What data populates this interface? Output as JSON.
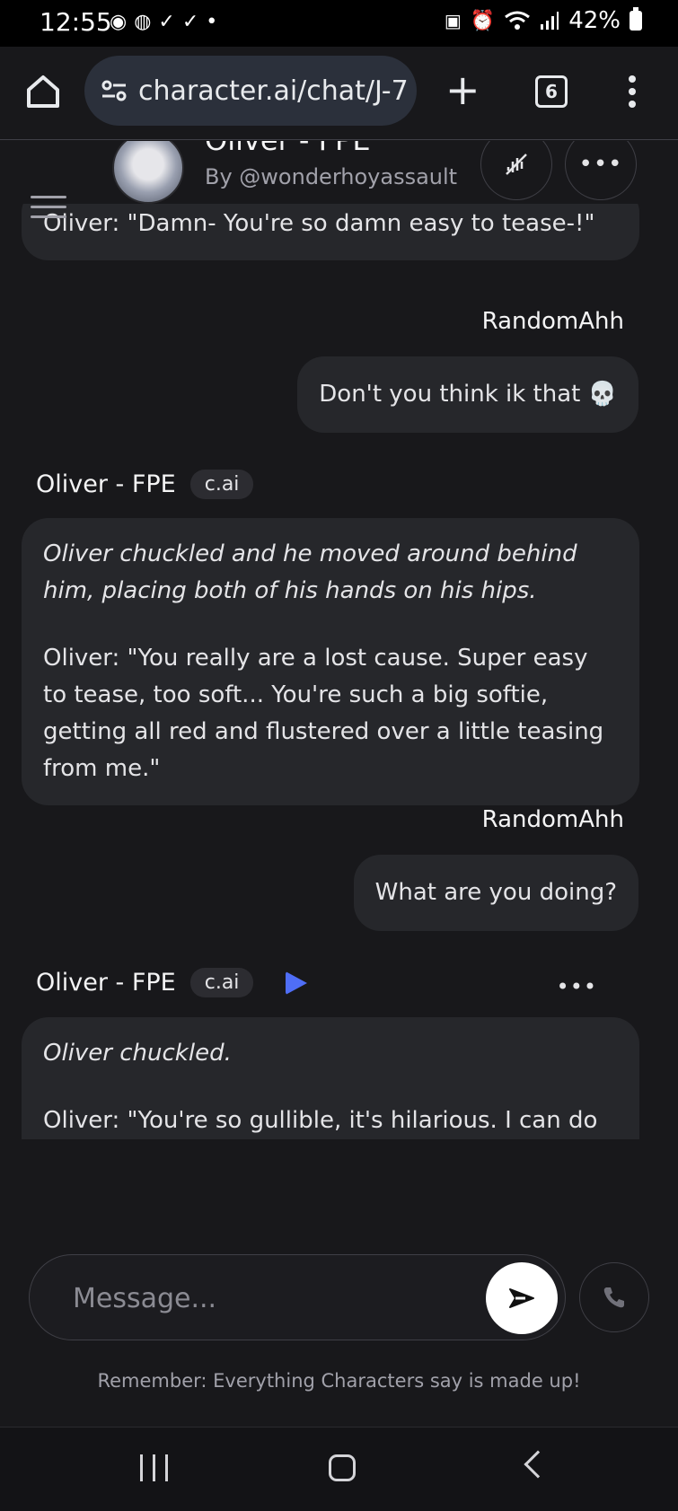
{
  "status_bar": {
    "time": "12:55",
    "battery": "42%"
  },
  "browser": {
    "url": "character.ai/chat/J-7",
    "tab_count": "6"
  },
  "header": {
    "character_name": "Oliver - FPE",
    "author": "By @wonderhoyassault"
  },
  "messages": [
    {
      "role": "bot",
      "paragraphs": [
        {
          "text": "Oliver: \"Damn- You're so damn easy to tease-!\"",
          "italic": false
        }
      ]
    },
    {
      "role": "user",
      "name": "RandomAhh",
      "text": "Don't you think ik that 💀"
    },
    {
      "role": "bot",
      "name": "Oliver - FPE",
      "badge": "c.ai",
      "paragraphs": [
        {
          "text": "Oliver chuckled and he moved around behind him, placing both of his hands on his hips.",
          "italic": true
        },
        {
          "text": "Oliver: \"You really are a lost cause. Super easy to tease, too soft... You're such a big softie, getting all red and flustered over a little teasing from me.\"",
          "italic": false
        }
      ]
    },
    {
      "role": "user",
      "name": "RandomAhh",
      "text": "What are you doing?"
    },
    {
      "role": "bot",
      "name": "Oliver - FPE",
      "badge": "c.ai",
      "paragraphs": [
        {
          "text": "Oliver chuckled.",
          "italic": true
        },
        {
          "text": "Oliver: \"You're so gullible, it's hilarious. I can do",
          "italic": false
        }
      ]
    }
  ],
  "composer": {
    "placeholder": "Message...",
    "value": ""
  },
  "disclaimer": "Remember: Everything Characters say is made up!",
  "colors": {
    "background": "#18181b",
    "bubble": "#26272b",
    "play_accent": "#4f6ef7"
  }
}
